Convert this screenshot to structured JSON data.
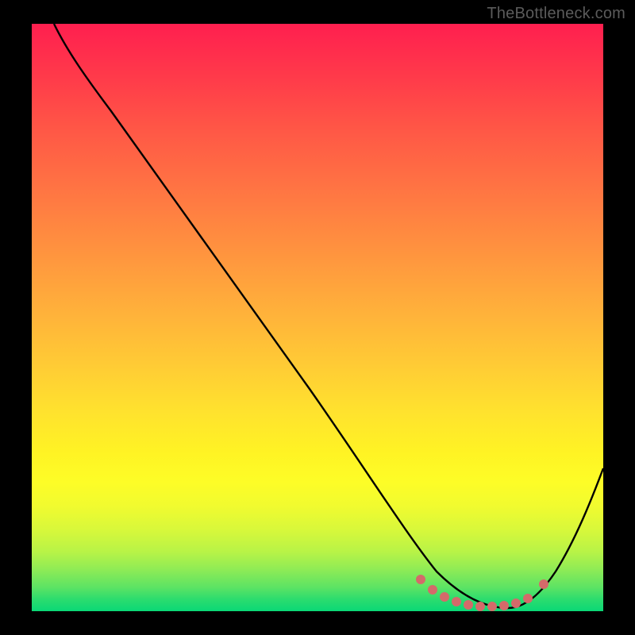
{
  "watermark": "TheBottleneck.com",
  "chart_data": {
    "type": "line",
    "title": "",
    "xlabel": "",
    "ylabel": "",
    "xlim": [
      0,
      100
    ],
    "ylim": [
      0,
      100
    ],
    "grid": false,
    "legend": false,
    "background": "red-yellow-green vertical gradient",
    "series": [
      {
        "name": "curve",
        "style": "solid-black",
        "x": [
          4,
          8,
          14,
          20,
          27,
          34,
          41,
          48,
          55,
          60,
          64,
          68,
          72,
          76,
          80,
          84,
          88,
          92,
          96,
          100
        ],
        "y": [
          100,
          97,
          92,
          85,
          76,
          67,
          58,
          49,
          40,
          32,
          25,
          18,
          12,
          7,
          3,
          1,
          1,
          5,
          13,
          25
        ]
      },
      {
        "name": "valley-markers",
        "style": "salmon-dots",
        "x": [
          67,
          70,
          73,
          76,
          79,
          82,
          85,
          88
        ],
        "y": [
          6,
          3,
          2,
          1,
          1,
          1,
          2,
          5
        ]
      }
    ],
    "gradient_stops": [
      {
        "pos": 0.0,
        "color": "#ff1f4f"
      },
      {
        "pos": 0.18,
        "color": "#ff5746"
      },
      {
        "pos": 0.38,
        "color": "#ff913f"
      },
      {
        "pos": 0.58,
        "color": "#ffcb35"
      },
      {
        "pos": 0.73,
        "color": "#fff324"
      },
      {
        "pos": 0.86,
        "color": "#d9f83a"
      },
      {
        "pos": 0.96,
        "color": "#5be364"
      },
      {
        "pos": 1.0,
        "color": "#0ad876"
      }
    ]
  },
  "colors": {
    "frame": "#000000",
    "curve": "#000000",
    "markers": "#d46a6a",
    "watermark": "#5b5b5b"
  }
}
